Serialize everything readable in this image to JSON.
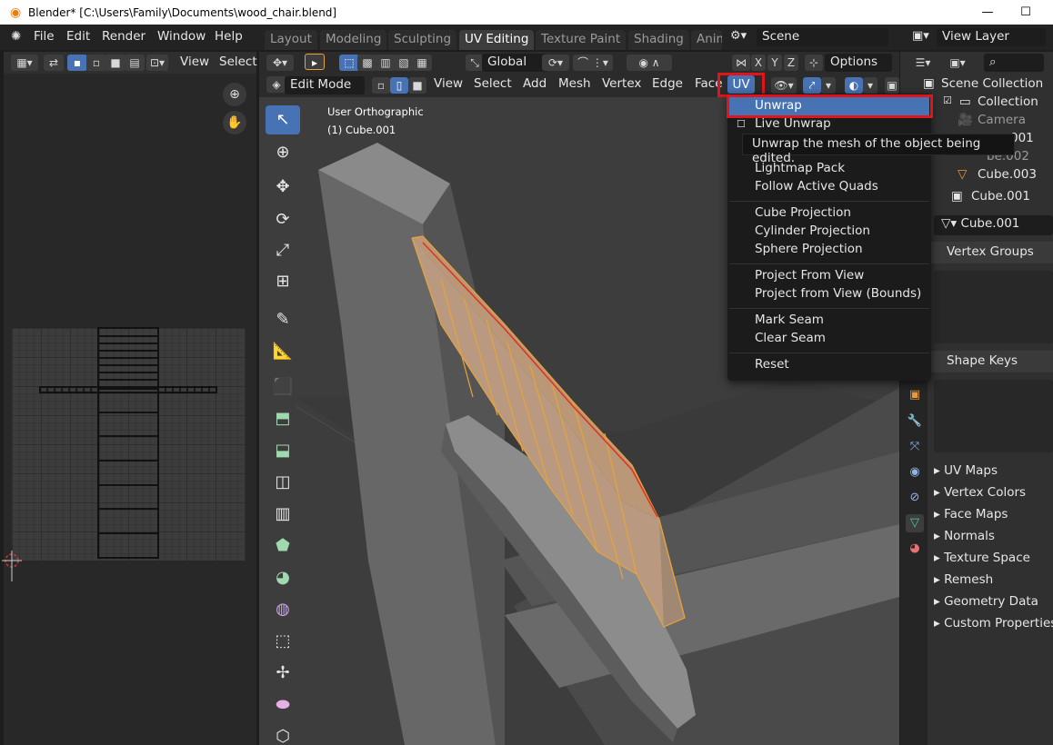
{
  "window": {
    "title": "Blender* [C:\\Users\\Family\\Documents\\wood_chair.blend]",
    "minimize": "—",
    "maximize": "☐"
  },
  "menubar": {
    "items": [
      "File",
      "Edit",
      "Render",
      "Window",
      "Help"
    ],
    "workspaces": [
      "Layout",
      "Modeling",
      "Sculpting",
      "UV Editing",
      "Texture Paint",
      "Shading",
      "Anim"
    ],
    "active_workspace": "UV Editing",
    "scene": "Scene",
    "view_layer": "View Layer"
  },
  "uv_editor": {
    "menus": [
      "View",
      "Select"
    ]
  },
  "viewport": {
    "transform_orientation": "Global",
    "options": "Options",
    "axis": [
      "X",
      "Y",
      "Z"
    ],
    "mode": "Edit Mode",
    "menus": [
      "View",
      "Select",
      "Add",
      "Mesh",
      "Vertex",
      "Edge",
      "Face",
      "UV"
    ],
    "overlay_title": "User Orthographic",
    "overlay_object": "(1) Cube.001"
  },
  "uv_menu": {
    "items": [
      {
        "label": "Unwrap",
        "hl": true
      },
      {
        "label": "Live Unwrap"
      },
      {
        "label": "Lightmap Pack"
      },
      {
        "label": "Follow Active Quads"
      },
      {
        "label": "Cube Projection"
      },
      {
        "label": "Cylinder Projection"
      },
      {
        "label": "Sphere Projection"
      },
      {
        "label": "Project From View"
      },
      {
        "label": "Project from View (Bounds)"
      },
      {
        "label": "Mark Seam"
      },
      {
        "label": "Clear Seam"
      },
      {
        "label": "Reset"
      }
    ],
    "tooltip": "Unwrap the mesh of the object being edited."
  },
  "outliner": {
    "scene_collection": "Scene Collection",
    "collection": "Collection",
    "camera": "Camera",
    "items": [
      "Cube.001",
      "Cube.002",
      "Cube.003"
    ],
    "item_partial": [
      "001",
      "be.002"
    ]
  },
  "properties": {
    "object": "Cube.001",
    "mesh": "Cube.001",
    "panels": [
      "Vertex Groups",
      "Shape Keys",
      "UV Maps",
      "Vertex Colors",
      "Face Maps",
      "Normals",
      "Texture Space",
      "Remesh",
      "Geometry Data",
      "Custom Properties"
    ]
  },
  "colors": {
    "accent": "#4772b3",
    "highlight_box": "#e0151b",
    "selection_orange": "#e8a33a"
  }
}
